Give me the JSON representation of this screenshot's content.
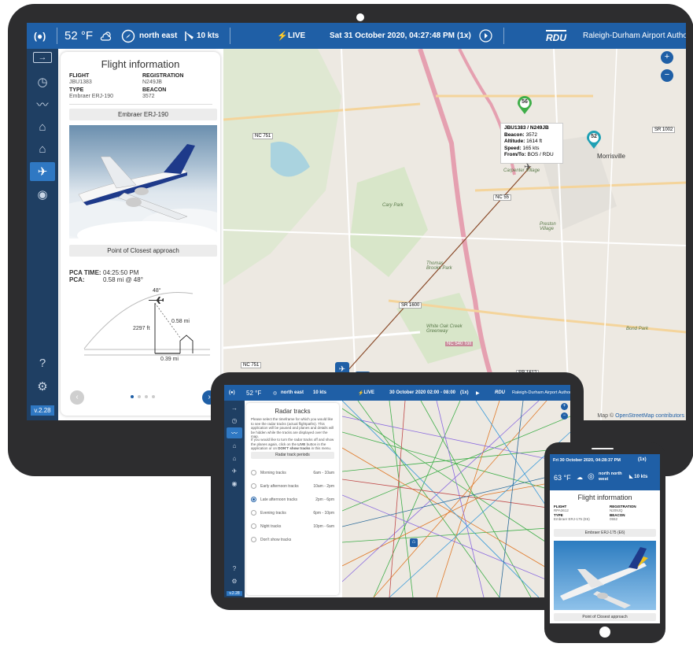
{
  "main": {
    "topbar": {
      "menu_icon": "(●)",
      "temperature": "52 °F",
      "wind_direction": "north east",
      "wind_speed": "10 kts",
      "live_label": "LIVE",
      "datetime": "Sat 31 October 2020, 04:27:48 PM",
      "speed_label": "(1x)",
      "authority_logo": "RDU",
      "authority_name": "Raleigh-Durham Airport Authority"
    },
    "version": "v.2.28",
    "flight_panel": {
      "title": "Flight information",
      "flight_label": "FLIGHT",
      "flight_value": "JBU1383",
      "registration_label": "REGISTRATION",
      "registration_value": "N249JB",
      "type_label": "TYPE",
      "type_value": "Embraer ERJ-190",
      "beacon_label": "BEACON",
      "beacon_value": "3572",
      "aircraft_name": "Embraer ERJ-190",
      "pca_header": "Point of Closest approach",
      "pca_time_label": "PCA TIME:",
      "pca_time_value": "04:25:50 PM",
      "pca_label": "PCA:",
      "pca_value": "0.58 mi @ 48°",
      "diagram_angle": "48°",
      "diagram_altitude": "2297 ft",
      "diagram_distance": "0.58 mi",
      "diagram_ground": "0.39 mi"
    },
    "map": {
      "tooltip_title": "JBU1383 / N249JB",
      "tooltip_rows": [
        {
          "label": "Beacon:",
          "value": "3572"
        },
        {
          "label": "Altitude:",
          "value": "1614 ft"
        },
        {
          "label": "Speed:",
          "value": "165 kts"
        },
        {
          "label": "From/To:",
          "value": "BOS / RDU"
        }
      ],
      "marker_a": "56",
      "marker_b": "52",
      "labels": {
        "morrisville": "Morrisville",
        "nc751_top": "NC 751",
        "nc751_bottom": "NC 751",
        "nc55": "NC 55",
        "sr1600": "SR 1600",
        "sr1002": "SR 1002",
        "sr1612": "SR 1612",
        "nc540": "NC 540 Toll",
        "cary_park": "Cary Park",
        "white_oak": "White Oak Creek Greenway",
        "carpenter": "Carpenter Village",
        "preston": "Preston Village",
        "bond_park": "Bond Park",
        "brooks": "Thomas Brooks Park"
      },
      "attribution_prefix": "Map © ",
      "attribution_link": "OpenStreetMap contributors",
      "zoom_in": "+",
      "zoom_out": "−"
    }
  },
  "tablet2": {
    "topbar": {
      "temperature": "52 °F",
      "wind_direction": "north east",
      "wind_speed": "10 kts",
      "live_label": "LIVE",
      "date": "30 October 2020",
      "time_range": "02:00 - 08:00",
      "speed_label": "(1x)",
      "authority_logo": "RDU",
      "authority_name": "Raleigh-Durham Airport Authority"
    },
    "version": "v.2.28",
    "title": "Radar tracks",
    "description": "Please select the timeframe for which you would like to see the radar tracks (actual flightpaths). This application will be paused and planes and details will be hidden while the tracks are displayed over the map.",
    "description2_a": "If you would like to turn the radar tracks off and show the planes again, click on the ",
    "description2_live": "LIVE",
    "description2_b": " button in the application or on ",
    "description2_dont": "DON'T show tracks",
    "description2_c": " in this menu.",
    "periods_button": "Radar track periods",
    "options": [
      {
        "label": "Morning tracks",
        "range": "6am - 10am",
        "selected": false
      },
      {
        "label": "Early afternoon tracks",
        "range": "10am - 2pm",
        "selected": false
      },
      {
        "label": "Late afternoon tracks",
        "range": "2pm - 6pm",
        "selected": true
      },
      {
        "label": "Evening tracks",
        "range": "6pm - 10pm",
        "selected": false
      },
      {
        "label": "Night tracks",
        "range": "10pm - 6am",
        "selected": false
      },
      {
        "label": "Don't show tracks",
        "range": "",
        "selected": false
      }
    ]
  },
  "phone": {
    "datetime": "Fri 30 October 2020, 04:28:37 PM",
    "speed_label": "(1x)",
    "temperature": "63 °F",
    "wind_direction": "north north west",
    "wind_speed": "10 kts",
    "title": "Flight information",
    "flight_label": "FLIGHT",
    "flight_value": "RPA3612",
    "registration_label": "REGISTRATION",
    "registration_value": "N209JQ",
    "type_label": "TYPE",
    "type_value": "Embraer ERJ-175 (E6)",
    "beacon_label": "BEACON",
    "beacon_value": "0552",
    "aircraft_name": "Embraer ERJ-175 (E6)",
    "pca_header": "Point of Closest approach"
  },
  "colors": {
    "topbar_blue": "#1f5fa6",
    "sidebar_navy": "#1f3f63",
    "marker_green": "#3fae49",
    "marker_teal": "#1fa0b4",
    "marker_blue": "#1f5fa6",
    "flight_path": "#8a4b2a"
  }
}
